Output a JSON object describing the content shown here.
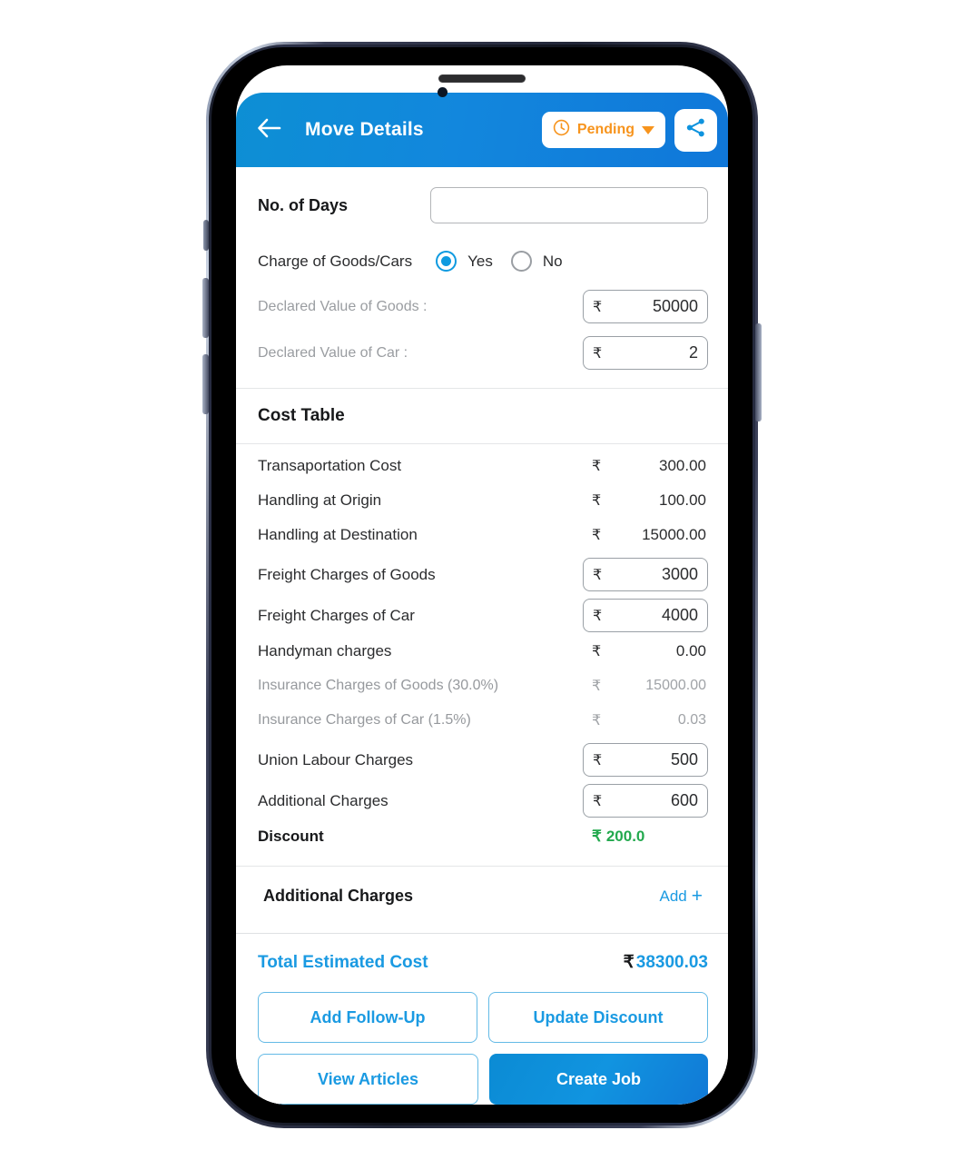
{
  "header": {
    "back_icon": "arrow-left-icon",
    "title": "Move Details",
    "status_icon": "clock-icon",
    "status_label": "Pending",
    "caret_icon": "chevron-down-icon",
    "share_icon": "share-icon",
    "accent_blue": "#1287dd",
    "status_orange": "#f7941d"
  },
  "form": {
    "days_label": "No. of Days",
    "days_value": "",
    "days_placeholder": "",
    "charge_label": "Charge of Goods/Cars",
    "radio_yes": "Yes",
    "radio_no": "No",
    "radio_selected": "Yes",
    "declared_goods_label": "Declared Value of Goods :",
    "declared_goods_currency": "₹",
    "declared_goods_value": "50000",
    "declared_car_label": "Declared Value of Car :",
    "declared_car_currency": "₹",
    "declared_car_value": "2"
  },
  "cost_table": {
    "title": "Cost Table",
    "rows": [
      {
        "label": "Transaportation Cost",
        "currency": "₹",
        "value": "300.00",
        "editable": false,
        "muted": false
      },
      {
        "label": "Handling at Origin",
        "currency": "₹",
        "value": "100.00",
        "editable": false,
        "muted": false
      },
      {
        "label": "Handling at Destination",
        "currency": "₹",
        "value": "15000.00",
        "editable": false,
        "muted": false
      },
      {
        "label": "Freight Charges of Goods",
        "currency": "₹",
        "value": "3000",
        "editable": true,
        "muted": false
      },
      {
        "label": "Freight Charges of Car",
        "currency": "₹",
        "value": "4000",
        "editable": true,
        "muted": false
      },
      {
        "label": "Handyman charges",
        "currency": "₹",
        "value": "0.00",
        "editable": false,
        "muted": false
      },
      {
        "label": "Insurance Charges of Goods (30.0%)",
        "currency": "₹",
        "value": "15000.00",
        "editable": false,
        "muted": true
      },
      {
        "label": "Insurance Charges of Car (1.5%)",
        "currency": "₹",
        "value": "0.03",
        "editable": false,
        "muted": true
      },
      {
        "label": "Union Labour Charges",
        "currency": "₹",
        "value": "500",
        "editable": true,
        "muted": false
      },
      {
        "label": "Additional Charges",
        "currency": "₹",
        "value": "600",
        "editable": true,
        "muted": false
      }
    ],
    "discount_label": "Discount",
    "discount_currency": "₹",
    "discount_value": "200.0",
    "discount_color": "#23a94e"
  },
  "additional_charges": {
    "title": "Additional Charges",
    "add_label": "Add",
    "add_icon": "plus-icon"
  },
  "total": {
    "label": "Total Estimated Cost",
    "currency": "₹",
    "value": "38300.03",
    "color": "#1a9ae2"
  },
  "actions": {
    "add_follow_up": "Add Follow-Up",
    "update_discount": "Update Discount",
    "view_articles": "View Articles",
    "create_job": "Create Job"
  }
}
